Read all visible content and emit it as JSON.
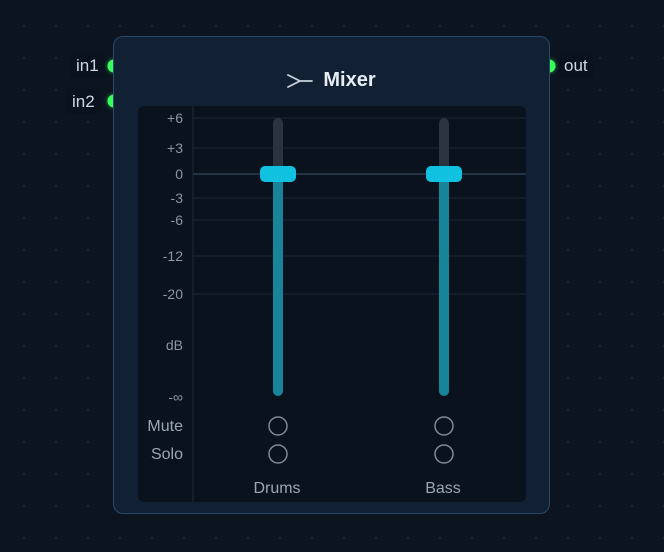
{
  "node": {
    "title": "Mixer",
    "icon": "merge-icon",
    "inputs": [
      "in1",
      "in2"
    ],
    "outputs": [
      "out"
    ]
  },
  "scale": {
    "ticks": [
      "+6",
      "+3",
      "0",
      "-3",
      "-6",
      "-12",
      "-20",
      "-∞"
    ],
    "unit": "dB"
  },
  "rows": {
    "mute": "Mute",
    "solo": "Solo"
  },
  "channels": [
    {
      "name": "Drums",
      "level_db": 0,
      "mute": false,
      "solo": false
    },
    {
      "name": "Bass",
      "level_db": 0,
      "mute": false,
      "solo": false
    }
  ],
  "colors": {
    "accent": "#11c2e0",
    "port": "#39ff5a",
    "node_bg": "#122034",
    "panel_bg": "#0a121d"
  }
}
